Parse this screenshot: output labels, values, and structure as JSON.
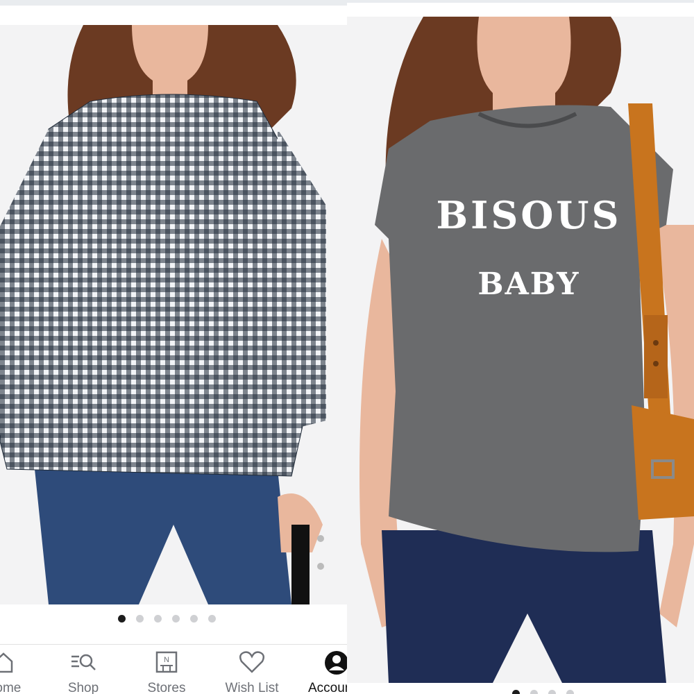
{
  "left_screen": {
    "carousel": {
      "dots": 6,
      "active_index": 0
    },
    "tabbar": {
      "items": [
        {
          "label": "Home",
          "icon": "home-icon"
        },
        {
          "label": "Shop",
          "icon": "shop-search-icon"
        },
        {
          "label": "Stores",
          "icon": "store-icon"
        },
        {
          "label": "Wish List",
          "icon": "heart-icon"
        },
        {
          "label": "Account",
          "icon": "account-icon"
        }
      ]
    }
  },
  "right_screen": {
    "product_print": {
      "line1": "BISOUS",
      "line2": "BABY"
    },
    "carousel": {
      "dots": 4,
      "active_index": 0
    }
  },
  "colors": {
    "gingham_dark": "#1f2a38",
    "tshirt_grey": "#6a6b6d",
    "denim": "#2e4b7a",
    "bag_tan": "#c8741e",
    "hair": "#6b3a22",
    "active_dot": "#1c1c1c"
  }
}
